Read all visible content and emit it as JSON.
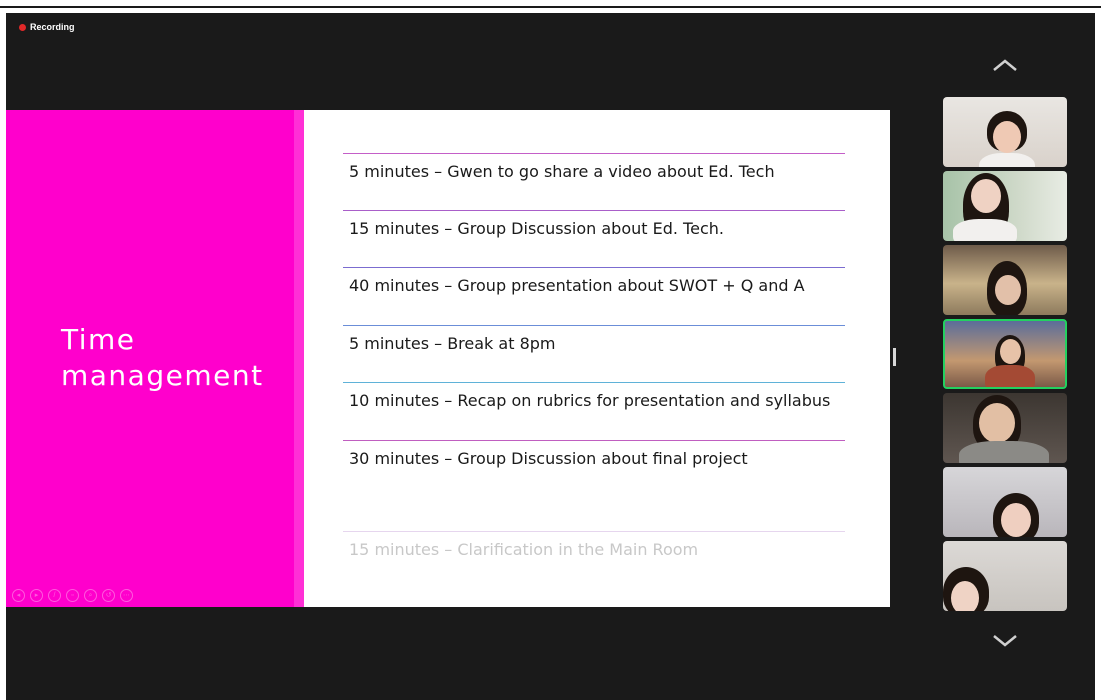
{
  "meeting": {
    "recording_label": "Recording",
    "recording_color": "#e02828"
  },
  "slide": {
    "title_line1": "Time",
    "title_line2": "management",
    "accent_color": "#ff00cc",
    "agenda": [
      "5 minutes – Gwen to go share a video about Ed. Tech",
      "15 minutes – Group Discussion about Ed. Tech.",
      "40 minutes – Group presentation about SWOT + Q and A",
      "5 minutes – Break at 8pm",
      "10 minutes – Recap on rubrics for presentation and syllabus",
      "30 minutes – Group Discussion about final project",
      "15 minutes – Clarification in the Main Room"
    ],
    "toolbar_icons": [
      "prev-icon",
      "next-icon",
      "pen-icon",
      "pointer-icon",
      "zoom-icon",
      "undo-icon",
      "more-icon"
    ]
  },
  "thumbnail_bar": {
    "up_icon": "chevron-up-icon",
    "down_icon": "chevron-down-icon",
    "active_border_color": "#23d160"
  }
}
